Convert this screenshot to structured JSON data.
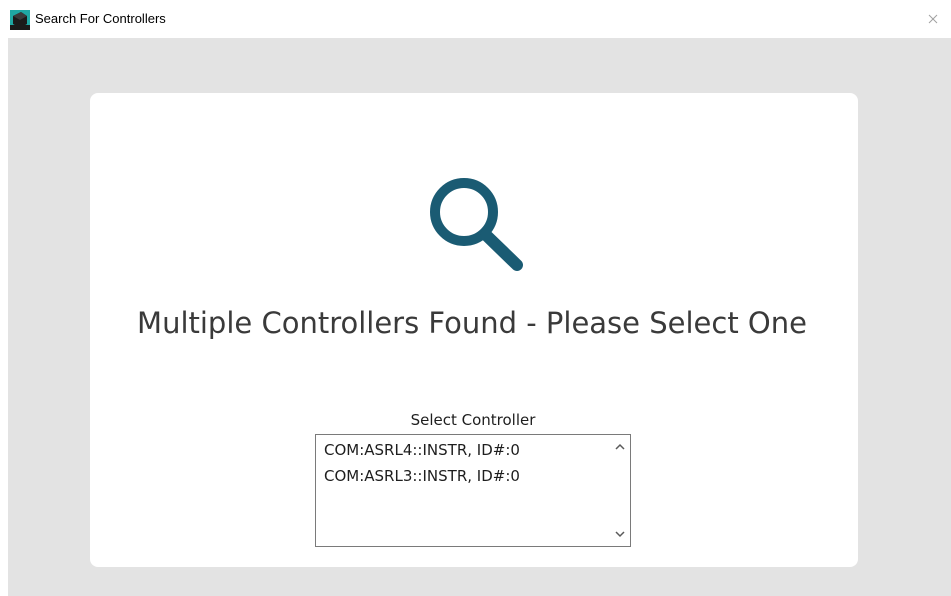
{
  "window": {
    "title": "Search For Controllers",
    "close_glyph": "×"
  },
  "icons": {
    "app": "app-logo-icon",
    "close": "close-icon",
    "search": "magnifying-glass-icon",
    "scroll_up": "chevron-up-icon",
    "scroll_down": "chevron-down-icon"
  },
  "colors": {
    "accent": "#1a5b73",
    "background": "#e3e3e3",
    "card": "#ffffff"
  },
  "main": {
    "heading": "Multiple Controllers Found - Please Select One",
    "list_label": "Select Controller",
    "controllers": [
      "COM:ASRL4::INSTR, ID#:0",
      "COM:ASRL3::INSTR, ID#:0"
    ]
  }
}
